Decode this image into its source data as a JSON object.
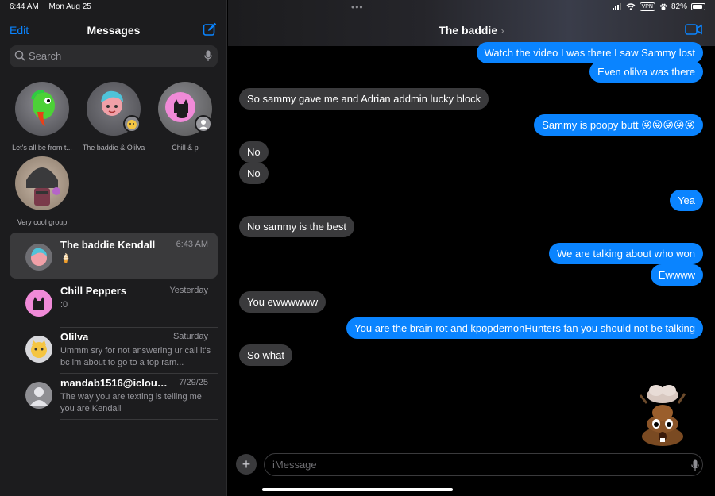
{
  "status": {
    "time": "6:44 AM",
    "date": "Mon Aug 25",
    "vpn": "VPN",
    "battery": "82%"
  },
  "sidebar": {
    "edit_label": "Edit",
    "title": "Messages",
    "search_placeholder": "Search",
    "pinned": [
      {
        "label": "Let's all be from t..."
      },
      {
        "label": "The baddie & Olilva"
      },
      {
        "label": "Chill & p"
      },
      {
        "label": "Very cool group"
      }
    ],
    "conversations": [
      {
        "name": "The baddie Kendall",
        "time": "6:43 AM",
        "preview": "🍦"
      },
      {
        "name": "Chill Peppers",
        "time": "Yesterday",
        "preview": ":0"
      },
      {
        "name": "Olilva",
        "time": "Saturday",
        "preview": "Ummm sry for not answering ur call it's bc im about to go to a top ram..."
      },
      {
        "name": "mandab1516@icloud....",
        "time": "7/29/25",
        "preview": "The way you are texting is telling me you are Kendall"
      }
    ]
  },
  "chat": {
    "contact_name": "The baddie",
    "messages": [
      {
        "dir": "out",
        "text": "Watch the video I was there I saw Sammy lost"
      },
      {
        "dir": "out",
        "text": "Even olilva was there"
      },
      {
        "dir": "in",
        "text": "So sammy gave me and Adrian addmin lucky block"
      },
      {
        "dir": "out",
        "text": "Sammy is poopy butt 😜😜😜😜😜"
      },
      {
        "dir": "in",
        "text": "No"
      },
      {
        "dir": "in",
        "text": "No"
      },
      {
        "dir": "out",
        "text": "Yea"
      },
      {
        "dir": "in",
        "text": "No sammy is the best"
      },
      {
        "dir": "out",
        "text": "We are talking about who won"
      },
      {
        "dir": "out",
        "text": "Ewwww"
      },
      {
        "dir": "in",
        "text": "You ewwwwww"
      },
      {
        "dir": "out",
        "text": "You are the brain rot and kpopdemonHunters fan you should not be talking"
      },
      {
        "dir": "in",
        "text": "So what"
      }
    ],
    "input_placeholder": "iMessage"
  },
  "colors": {
    "accent": "#0a84ff",
    "incoming_bubble": "#3a3a3c",
    "sidebar_bg": "#1c1c1e"
  }
}
